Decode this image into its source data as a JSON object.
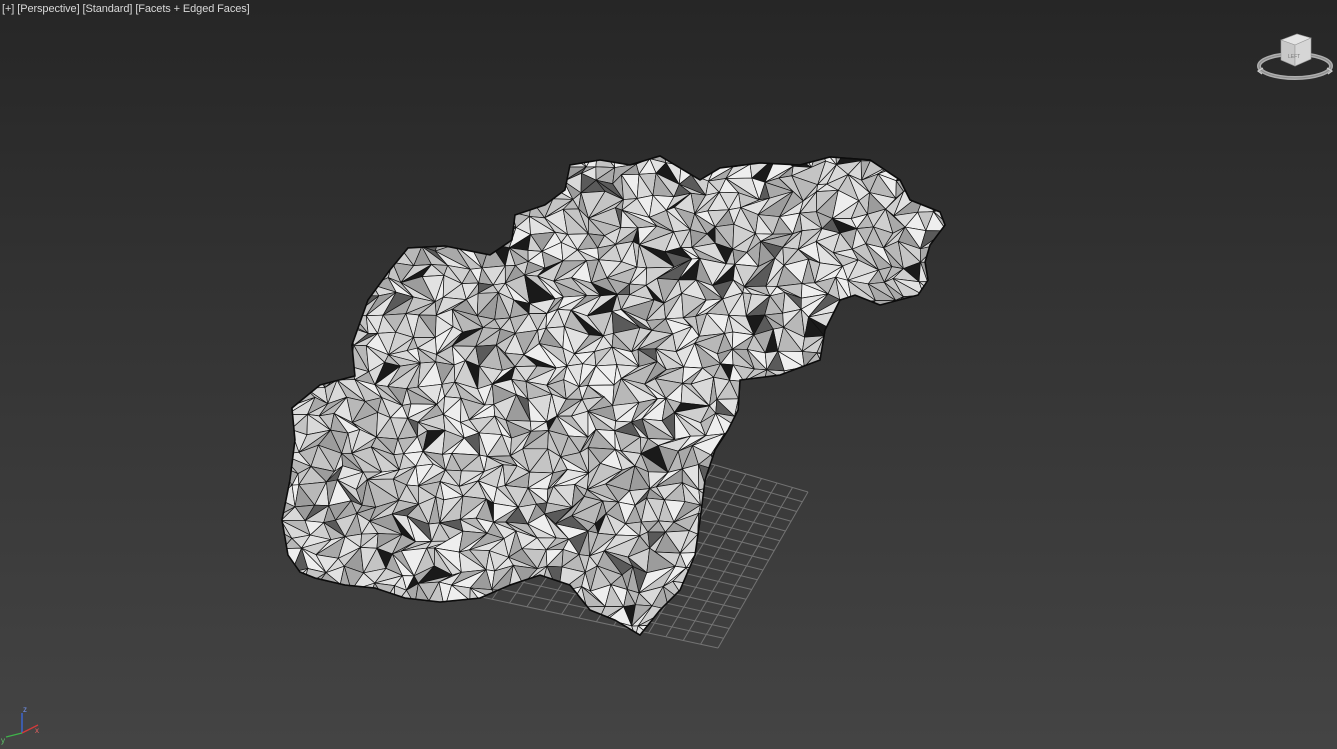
{
  "viewport": {
    "labels": {
      "plus": "[+]",
      "view": "[Perspective]",
      "shading_style": "[Standard]",
      "display_mode": "[Facets + Edged Faces]"
    },
    "viewcube": {
      "face_label": "LEFT",
      "icon": "viewcube-icon"
    },
    "axis_tripod": {
      "z_label": "z",
      "x_label": "x",
      "y_label": "y"
    },
    "colors": {
      "background_top": "#262626",
      "background_bottom": "#444444",
      "mesh_fill": "#d9d9d9",
      "mesh_shadow": "#7a7a7a",
      "mesh_edge": "#111111",
      "grid": "#7c7c7c",
      "axis_x": "#d23a3a",
      "axis_y": "#3fb24a",
      "axis_z": "#3b66d8"
    }
  }
}
